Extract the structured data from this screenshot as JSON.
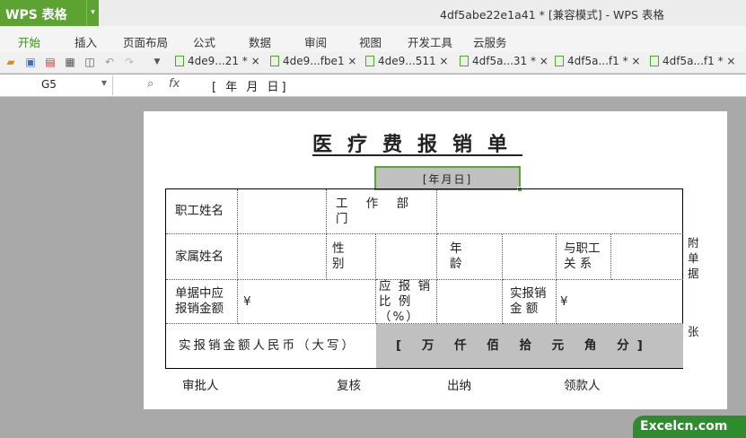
{
  "app": {
    "logo": "WPS 表格",
    "window_title": "4df5abe22e1a41 * [兼容模式] - WPS 表格"
  },
  "menu": [
    "开始",
    "插入",
    "页面布局",
    "公式",
    "数据",
    "审阅",
    "视图",
    "开发工具",
    "云服务"
  ],
  "tabs": [
    "4de9...21 * ×",
    "4de9...fbe1 ×",
    "4de9...511 ×",
    "4df5a...31 * ×",
    "4df5a...f1 * ×",
    "4df5a...f1 * ×"
  ],
  "formula": {
    "cell": "G5",
    "fx": "fx",
    "value": "[ 年 月 日]"
  },
  "sheet": {
    "title": "医疗费报销单",
    "date": "[年月日]",
    "r1": {
      "employee_name": "职工姓名",
      "department": "工 作 部 门"
    },
    "r2": {
      "family_name": "家属姓名",
      "gender": "性 别",
      "age": "年 龄",
      "relation": "与职工 关 系"
    },
    "r3": {
      "claim_amount": "单据中应 报销金额",
      "yen1": "¥",
      "ratio": "应 报 销 比 例（%）",
      "actual": "实报销 金 额",
      "yen2": "¥"
    },
    "r4": {
      "label": "实报销金额人民币（大写）",
      "value": "[ 万 仟 佰 拾 元 角 分]"
    },
    "side1": "附单据",
    "side2": "张",
    "signers": [
      "审批人",
      "复核",
      "出纳",
      "领款人"
    ]
  },
  "watermark": "Excelcn.com"
}
